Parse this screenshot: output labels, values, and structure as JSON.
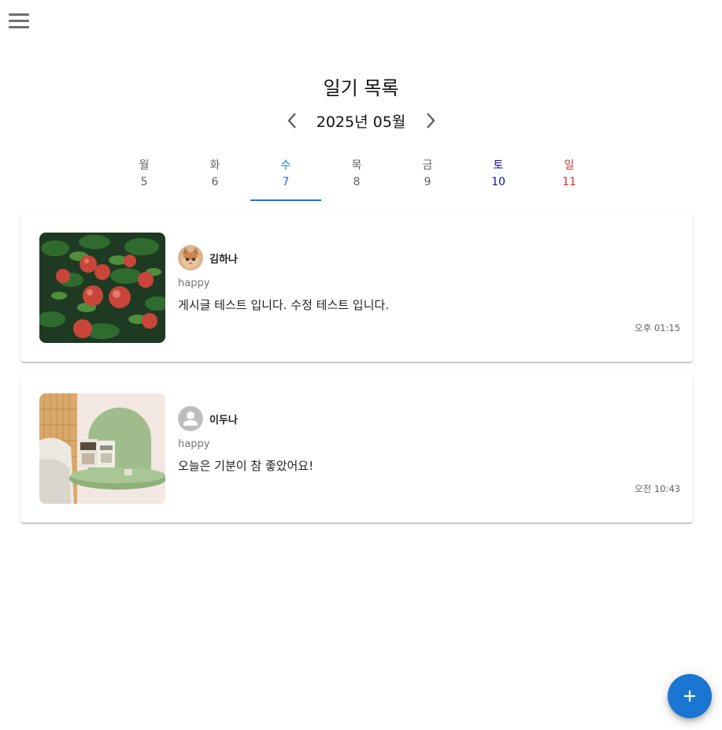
{
  "header": {
    "title": "일기 목록",
    "month": "2025년 05월"
  },
  "week": [
    {
      "name": "월",
      "num": "5"
    },
    {
      "name": "화",
      "num": "6"
    },
    {
      "name": "수",
      "num": "7"
    },
    {
      "name": "목",
      "num": "8"
    },
    {
      "name": "금",
      "num": "9"
    },
    {
      "name": "토",
      "num": "10"
    },
    {
      "name": "일",
      "num": "11"
    }
  ],
  "selected_day": "7",
  "colors": {
    "accent": "#1976d2",
    "saturday": "#0d12a8",
    "sunday": "#d32f2f"
  },
  "entries": [
    {
      "author": "김하나",
      "avatar": "kitten-photo",
      "thumbnail": "apple-tree-photo",
      "mood": "happy",
      "content": "게시글 테스트 입니다. 수정 테스트 입니다.",
      "time": "오후 01:15"
    },
    {
      "author": "이두나",
      "avatar": "default-person-icon",
      "thumbnail": "bedside-shelf-photo",
      "mood": "happy",
      "content": "오늘은 기분이 참 좋았어요!",
      "time": "오전 10:43"
    }
  ],
  "icons": {
    "menu": "menu-icon",
    "prev": "chevron-left-icon",
    "next": "chevron-right-icon",
    "add": "plus-icon"
  }
}
